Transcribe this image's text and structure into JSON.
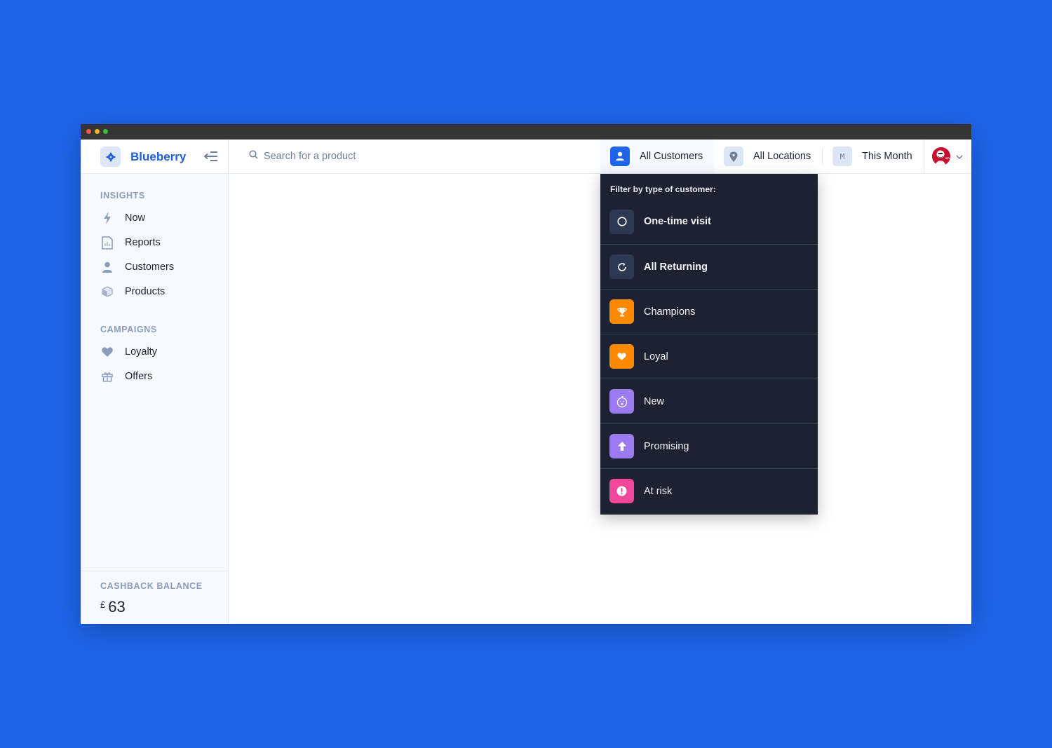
{
  "window": {
    "controls": [
      "close",
      "minimize",
      "maximize"
    ]
  },
  "brand": {
    "name": "Blueberry",
    "logo_icon": "blueberry-logo-icon",
    "collapse_icon": "collapse-sidebar-icon"
  },
  "search": {
    "placeholder": "Search for a product",
    "value": "",
    "icon": "search-icon"
  },
  "filters": {
    "customers": {
      "label": "All Customers",
      "icon": "user-icon",
      "active": true
    },
    "locations": {
      "label": "All Locations",
      "icon": "location-pin-icon"
    },
    "period": {
      "label": "This Month",
      "badge": "M"
    }
  },
  "account": {
    "avatar": "kfc-logo-avatar",
    "menu_icon": "chevron-down-icon"
  },
  "sidebar": {
    "sections": [
      {
        "title": "INSIGHTS",
        "items": [
          {
            "label": "Now",
            "icon": "lightning-icon"
          },
          {
            "label": "Reports",
            "icon": "report-icon"
          },
          {
            "label": "Customers",
            "icon": "user-icon"
          },
          {
            "label": "Products",
            "icon": "box-icon"
          }
        ]
      },
      {
        "title": "CAMPAIGNS",
        "items": [
          {
            "label": "Loyalty",
            "icon": "heart-icon"
          },
          {
            "label": "Offers",
            "icon": "gift-icon"
          }
        ]
      }
    ],
    "cashback": {
      "label": "CASHBACK BALANCE",
      "currency": "£",
      "amount": "63"
    }
  },
  "customer_filter_menu": {
    "title": "Filter by type of customer:",
    "options": [
      {
        "label": "One-time visit",
        "icon": "circle-icon",
        "color": "#2d3952",
        "bold": true
      },
      {
        "label": "All Returning",
        "icon": "refresh-icon",
        "color": "#2d3952",
        "bold": true
      },
      {
        "label": "Champions",
        "icon": "trophy-icon",
        "color": "#ff8a00",
        "bold": false
      },
      {
        "label": "Loyal",
        "icon": "heart-icon",
        "color": "#ff8a00",
        "bold": false
      },
      {
        "label": "New",
        "icon": "baby-face-icon",
        "color": "#9b7bf0",
        "bold": false
      },
      {
        "label": "Promising",
        "icon": "arrow-up-icon",
        "color": "#9b7bf0",
        "bold": false
      },
      {
        "label": "At risk",
        "icon": "exclamation-icon",
        "color": "#f0479a",
        "bold": false
      }
    ]
  },
  "colors": {
    "background": "#1f65ea",
    "brand": "#1f5fd8",
    "menu_bg": "#1c2232",
    "sidebar_bg": "#f6f9fd"
  }
}
